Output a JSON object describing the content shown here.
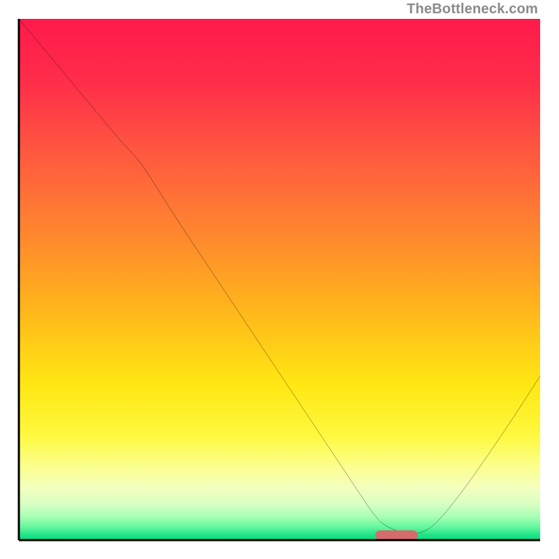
{
  "watermark": "TheBottleneck.com",
  "gradient": {
    "stops": [
      {
        "offset": 0.0,
        "color": "#ff1a4b"
      },
      {
        "offset": 0.12,
        "color": "#ff2d4a"
      },
      {
        "offset": 0.25,
        "color": "#ff5640"
      },
      {
        "offset": 0.4,
        "color": "#ff8330"
      },
      {
        "offset": 0.55,
        "color": "#ffb31c"
      },
      {
        "offset": 0.7,
        "color": "#ffe712"
      },
      {
        "offset": 0.8,
        "color": "#fef93f"
      },
      {
        "offset": 0.86,
        "color": "#fbff8f"
      },
      {
        "offset": 0.9,
        "color": "#f3ffbf"
      },
      {
        "offset": 0.93,
        "color": "#d9ffc3"
      },
      {
        "offset": 0.955,
        "color": "#a9ffb4"
      },
      {
        "offset": 0.975,
        "color": "#63f79e"
      },
      {
        "offset": 0.99,
        "color": "#1fe588"
      },
      {
        "offset": 1.0,
        "color": "#0fd77f"
      }
    ]
  },
  "marker": {
    "left_frac": 0.683,
    "width_frac": 0.082,
    "bottom_frac": 0.0
  },
  "chart_data": {
    "type": "line",
    "title": "",
    "xlabel": "",
    "ylabel": "",
    "xlim": [
      0,
      1
    ],
    "ylim": [
      0,
      1
    ],
    "x": [
      0.0,
      0.05,
      0.1,
      0.15,
      0.2,
      0.225,
      0.25,
      0.3,
      0.35,
      0.4,
      0.45,
      0.5,
      0.55,
      0.6,
      0.65,
      0.68,
      0.7,
      0.74,
      0.77,
      0.8,
      0.85,
      0.9,
      0.95,
      1.0
    ],
    "values": [
      1.0,
      0.94,
      0.88,
      0.82,
      0.76,
      0.735,
      0.7,
      0.62,
      0.545,
      0.47,
      0.395,
      0.32,
      0.245,
      0.17,
      0.095,
      0.05,
      0.028,
      0.012,
      0.012,
      0.03,
      0.092,
      0.163,
      0.237,
      0.315
    ],
    "series_name": "bottleneck-curve",
    "optimal_range_x": [
      0.683,
      0.765
    ]
  }
}
